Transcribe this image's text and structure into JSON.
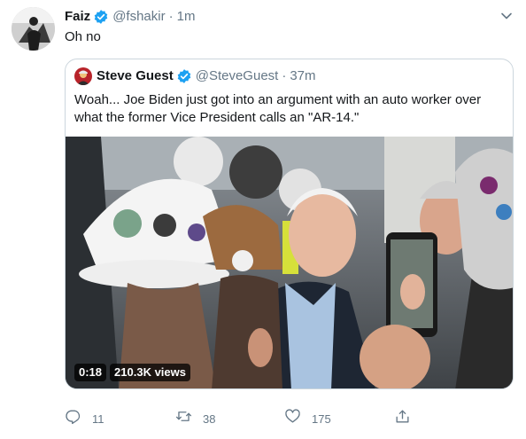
{
  "author": {
    "name": "Faiz",
    "handle": "@fshakir",
    "separator": "·",
    "time": "1m"
  },
  "tweet": {
    "text": "Oh no"
  },
  "quoted": {
    "name": "Steve Guest",
    "handle": "@SteveGuest",
    "separator": "·",
    "time": "37m",
    "text": "Woah... Joe Biden just got into an argument with an auto worker over what the former Vice President calls an \"AR-14.\"",
    "video": {
      "duration": "0:18",
      "views": "210.3K views"
    }
  },
  "actions": {
    "reply_count": "11",
    "retweet_count": "38",
    "like_count": "175"
  },
  "icons": {
    "verified": "verified-badge-icon",
    "menu": "chevron-down-icon",
    "reply": "reply-icon",
    "retweet": "retweet-icon",
    "like": "heart-icon",
    "share": "share-icon"
  },
  "colors": {
    "verified_blue": "#1da1f2",
    "secondary_text": "#657786",
    "border": "#ccd6dd"
  }
}
